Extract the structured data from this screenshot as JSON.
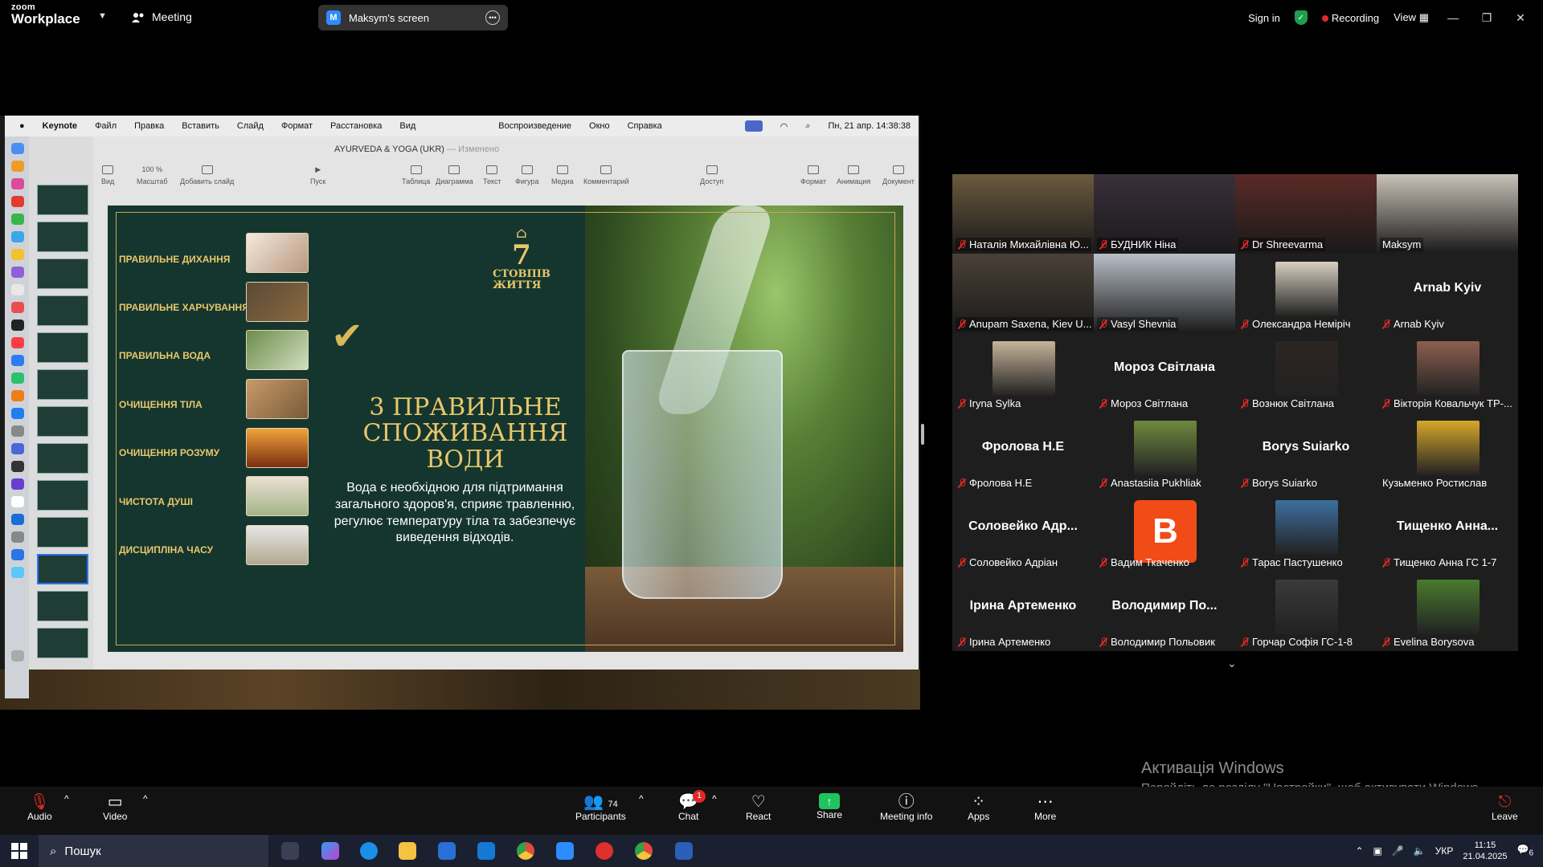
{
  "topbar": {
    "logo_line1": "zoom",
    "logo_line2": "Workplace",
    "meeting_label": "Meeting",
    "screen_pill": "Maksym's screen",
    "screen_initial": "M",
    "sign_in": "Sign in",
    "recording": "Recording",
    "view": "View"
  },
  "mac": {
    "menus": [
      "Keynote",
      "Файл",
      "Правка",
      "Вставить",
      "Слайд",
      "Формат",
      "Расстановка",
      "Вид",
      "Воспроизведение",
      "Окно",
      "Справка"
    ],
    "clock": "Пн, 21 апр. 14:38:38"
  },
  "keynote": {
    "doc_title": "AYURVEDA & YOGA (UKR)",
    "doc_status": "— Изменено",
    "tools": [
      {
        "label": "Вид"
      },
      {
        "label": "Масштаб",
        "value": "100 %"
      },
      {
        "label": "Добавить слайд"
      },
      {
        "label": "Пуск"
      },
      {
        "label": "Таблица"
      },
      {
        "label": "Диаграмма"
      },
      {
        "label": "Текст"
      },
      {
        "label": "Фигура"
      },
      {
        "label": "Медиа"
      },
      {
        "label": "Комментарий"
      },
      {
        "label": "Доступ"
      },
      {
        "label": "Формат"
      },
      {
        "label": "Анимация"
      },
      {
        "label": "Документ"
      }
    ]
  },
  "slide": {
    "emblem_number": "7",
    "emblem_text1": "СТОВПІВ",
    "emblem_text2": "ЖИТТЯ",
    "items": [
      "ПРАВИЛЬНЕ ДИХАННЯ",
      "ПРАВИЛЬНЕ ХАРЧУВАННЯ",
      "ПРАВИЛЬНА ВОДА",
      "ОЧИЩЕННЯ ТІЛА",
      "ОЧИЩЕННЯ РОЗУМУ",
      "ЧИСТОТА ДУШІ",
      "ДИСЦИПЛІНА ЧАСУ"
    ],
    "heading": "3 ПРАВИЛЬНЕ СПОЖИВАННЯ ВОДИ",
    "body": "Вода є необхідною для підтримання загального здоров'я, сприяє травленню, регулює температуру тіла та забезпечує виведення відходів."
  },
  "gallery": {
    "tiles": [
      {
        "name": "Наталія Михайлівна Ю...",
        "muted": true,
        "kind": "video",
        "bg": "#6b5a3d"
      },
      {
        "name": "БУДНИК Ніна",
        "muted": true,
        "kind": "video",
        "bg": "#3a2f3c"
      },
      {
        "name": "Dr Shreevarma",
        "muted": true,
        "kind": "video",
        "bg": "#5a2a26",
        "active": true
      },
      {
        "name": "Maksym",
        "muted": false,
        "kind": "video",
        "bg": "#c9c2b8"
      },
      {
        "name": "Anupam Saxena, Kiev U...",
        "muted": true,
        "kind": "video",
        "bg": "#4a4037"
      },
      {
        "name": "Vasyl Shevnia",
        "muted": true,
        "kind": "video",
        "bg": "#b8bfc7"
      },
      {
        "name": "Олександра Неміріч",
        "muted": true,
        "kind": "photo",
        "bg": "#d8cfc0"
      },
      {
        "name": "Arnab Kyiv",
        "muted": true,
        "kind": "text",
        "display": "Arnab Kyiv"
      },
      {
        "name": "Iryna Sylka",
        "muted": true,
        "kind": "photo",
        "bg": "#c7b49a"
      },
      {
        "name": "Мороз Світлана",
        "muted": true,
        "kind": "text",
        "display": "Мороз Світлана"
      },
      {
        "name": "Вознюк Світлана",
        "muted": true,
        "kind": "photo",
        "bg": "#2d2622"
      },
      {
        "name": "Вікторія Ковальчук ТР-...",
        "muted": true,
        "kind": "photo",
        "bg": "#8d5f4f"
      },
      {
        "name": "Фролова Н.Е",
        "muted": true,
        "kind": "text",
        "display": "Фролова Н.Е"
      },
      {
        "name": "Anastasiia Pukhliak",
        "muted": true,
        "kind": "photo",
        "bg": "#6f8a3d"
      },
      {
        "name": "Borys Suiarko",
        "muted": true,
        "kind": "text",
        "display": "Borys Suiarko"
      },
      {
        "name": "Кузьменко Ростислав",
        "muted": false,
        "kind": "photo",
        "bg": "#d6a72a"
      },
      {
        "name": "Соловейко Адріан",
        "muted": true,
        "kind": "text",
        "display": "Соловейко Адр..."
      },
      {
        "name": "Вадим Ткаченко",
        "muted": true,
        "kind": "avatar",
        "display": "В"
      },
      {
        "name": "Тарас Пастушенко",
        "muted": true,
        "kind": "photo",
        "bg": "#3c6f9e"
      },
      {
        "name": "Тищенко Анна ГС 1-7",
        "muted": true,
        "kind": "text",
        "display": "Тищенко Анна..."
      },
      {
        "name": "Ірина Артеменко",
        "muted": true,
        "kind": "text",
        "display": "Ірина Артеменко"
      },
      {
        "name": "Володимир Польовик",
        "muted": true,
        "kind": "text",
        "display": "Володимир По..."
      },
      {
        "name": "Горчар Софія ГС-1-8",
        "muted": true,
        "kind": "photo",
        "bg": "#3a3a3a"
      },
      {
        "name": "Evelina Borysova",
        "muted": true,
        "kind": "photo",
        "bg": "#4a7a2e"
      }
    ]
  },
  "windows_notice": {
    "title": "Активація Windows",
    "subtitle": "Перейдіть до розділу \"Настройки\", щоб активувати Windows."
  },
  "controls": {
    "audio": "Audio",
    "video": "Video",
    "participants": "Participants",
    "participants_count": "74",
    "chat": "Chat",
    "chat_badge": "1",
    "react": "React",
    "share": "Share",
    "meeting_info": "Meeting info",
    "apps": "Apps",
    "more": "More",
    "leave": "Leave"
  },
  "taskbar": {
    "search_placeholder": "Пошук",
    "language": "УКР",
    "time": "11:15",
    "date": "21.04.2025",
    "notifications": "6"
  }
}
